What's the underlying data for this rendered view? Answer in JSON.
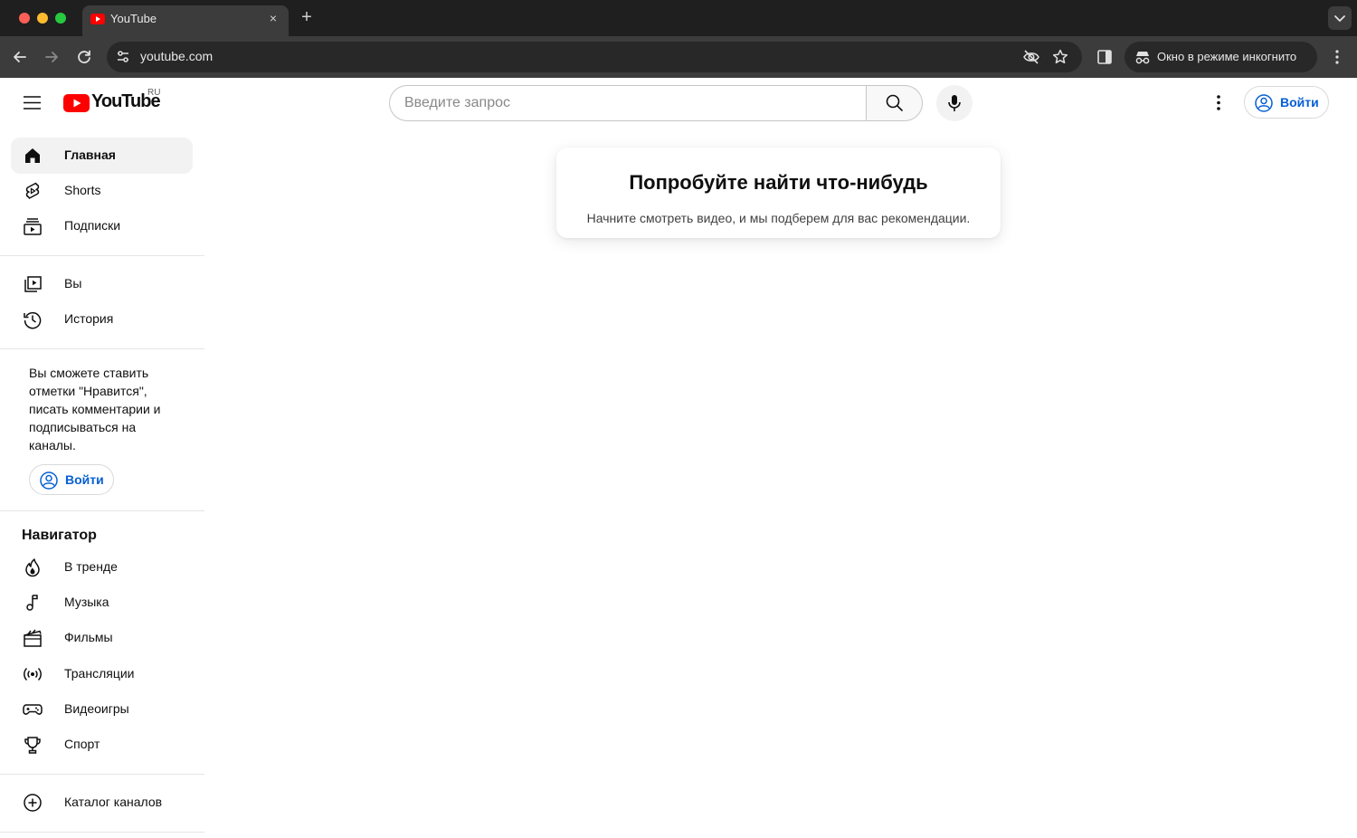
{
  "browser": {
    "tab_title": "YouTube",
    "tab_close": "×",
    "new_tab": "+",
    "url": "youtube.com",
    "incognito_label": "Окно в режиме инкогнито"
  },
  "masthead": {
    "logo_text": "YouTube",
    "region": "RU",
    "search_placeholder": "Введите запрос",
    "signin_label": "Войти"
  },
  "sidebar": {
    "main_items": [
      {
        "label": "Главная",
        "icon": "home-icon",
        "active": true
      },
      {
        "label": "Shorts",
        "icon": "shorts-icon"
      },
      {
        "label": "Подписки",
        "icon": "subscriptions-icon"
      }
    ],
    "you_items": [
      {
        "label": "Вы",
        "icon": "you-icon"
      },
      {
        "label": "История",
        "icon": "history-icon"
      }
    ],
    "signin_prompt": "Вы сможете ставить отметки \"Нравится\", писать комментарии и подписываться на каналы.",
    "signin_label": "Войти",
    "navigator_title": "Навигатор",
    "navigator_items": [
      {
        "label": "В тренде",
        "icon": "trending-icon"
      },
      {
        "label": "Музыка",
        "icon": "music-icon"
      },
      {
        "label": "Фильмы",
        "icon": "movies-icon"
      },
      {
        "label": "Трансляции",
        "icon": "live-icon"
      },
      {
        "label": "Видеоигры",
        "icon": "gaming-icon"
      },
      {
        "label": "Спорт",
        "icon": "sports-icon"
      }
    ],
    "catalog_item": {
      "label": "Каталог каналов",
      "icon": "add-circle-icon"
    }
  },
  "content": {
    "card_title": "Попробуйте найти что-нибудь",
    "card_subtitle": "Начните смотреть видео, и мы подберем для вас рекомендации."
  },
  "colors": {
    "brand_red": "#ff0000",
    "link_blue": "#065fd4",
    "chrome_dark": "#1f1f1f",
    "chrome_toolbar": "#3c3c3c"
  }
}
